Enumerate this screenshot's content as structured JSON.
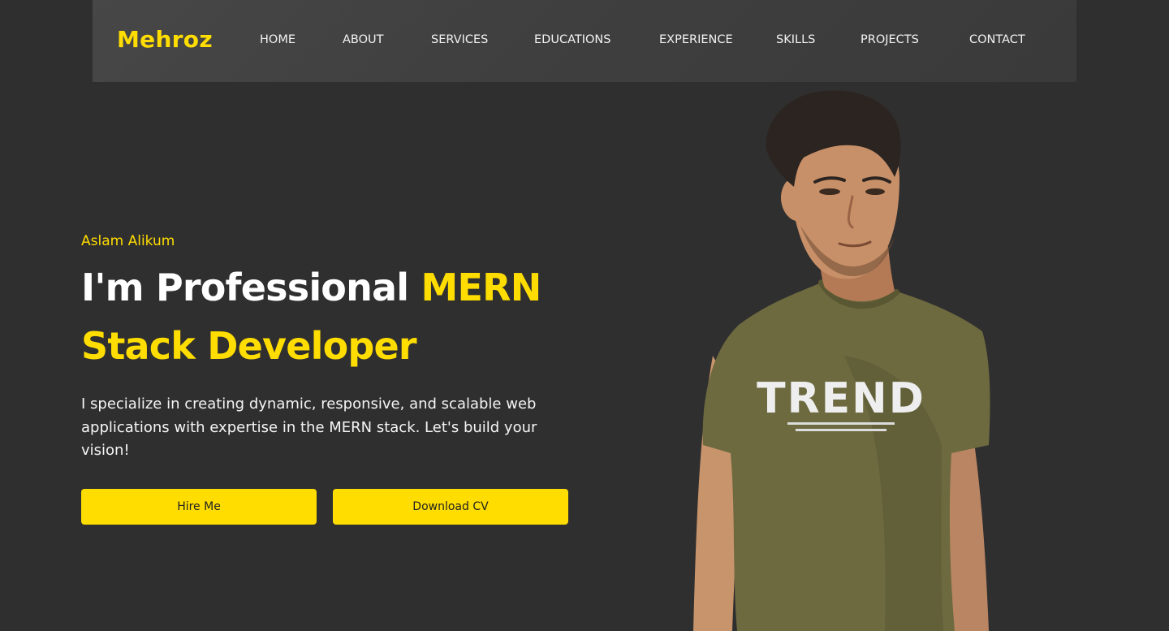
{
  "brand": {
    "logo": "Mehroz",
    "accent_color": "#ffdd00",
    "background_color": "#302f2f"
  },
  "nav": {
    "items": [
      {
        "label": "HOME"
      },
      {
        "label": "ABOUT"
      },
      {
        "label": "SERVICES"
      },
      {
        "label": "EDUCATIONS"
      },
      {
        "label": "EXPERIENCE"
      },
      {
        "label": "SKILLS"
      },
      {
        "label": "PROJECTS"
      },
      {
        "label": "CONTACT"
      }
    ]
  },
  "hero": {
    "greeting": "Aslam Alikum",
    "headline_prefix": "I'm Professional ",
    "headline_accent": "MERN Stack Developer",
    "description": "I specialize in creating dynamic, responsive, and scalable web applications with expertise in the MERN stack. Let's build your vision!",
    "buttons": {
      "hire": "Hire Me",
      "download": "Download CV"
    },
    "shirt_text": "TREND"
  }
}
